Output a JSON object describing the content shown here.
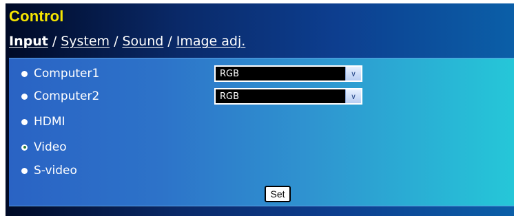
{
  "title": "Control",
  "nav": {
    "items": [
      {
        "label": "Input",
        "active": true
      },
      {
        "label": "System",
        "active": false
      },
      {
        "label": "Sound",
        "active": false
      },
      {
        "label": "Image adj.",
        "active": false
      }
    ],
    "separator": "/"
  },
  "inputs": {
    "options": [
      {
        "label": "Computer1",
        "selected": false,
        "select_value": "RGB"
      },
      {
        "label": "Computer2",
        "selected": false,
        "select_value": "RGB"
      },
      {
        "label": "HDMI",
        "selected": false
      },
      {
        "label": "Video",
        "selected": true
      },
      {
        "label": "S-video",
        "selected": false
      }
    ],
    "set_label": "Set"
  },
  "icons": {
    "dropdown": "chevron-down-icon",
    "radio": "radio-button-icon"
  },
  "colors": {
    "title": "#f5e500",
    "background_dark": "#000a26",
    "panel_left": "#2a63c4",
    "panel_right": "#25c7d8"
  }
}
